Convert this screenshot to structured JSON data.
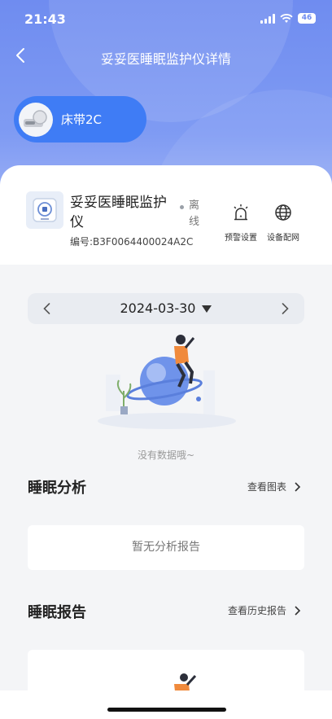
{
  "status_bar": {
    "time": "21:43",
    "battery": "46"
  },
  "header": {
    "title": "妥妥医睡眠监护仪详情"
  },
  "device_pill": {
    "label": "床带2C"
  },
  "device": {
    "name": "妥妥医睡眠监护仪",
    "serial": "编号:B3F0064400024A2C",
    "status": "离线"
  },
  "actions": [
    {
      "label": "预警设置",
      "icon": "alarm-light-icon"
    },
    {
      "label": "设备配网",
      "icon": "globe-icon"
    }
  ],
  "date_picker": {
    "date": "2024-03-30"
  },
  "empty_state": {
    "text": "没有数据哦~"
  },
  "sleep_analysis": {
    "title": "睡眠分析",
    "link": "查看图表",
    "empty": "暂无分析报告"
  },
  "sleep_report": {
    "title": "睡眠报告",
    "link": "查看历史报告"
  },
  "colors": {
    "hero": "#6f8cf0",
    "accent": "#3f7cf5",
    "page_bg": "#f4f5f7"
  }
}
